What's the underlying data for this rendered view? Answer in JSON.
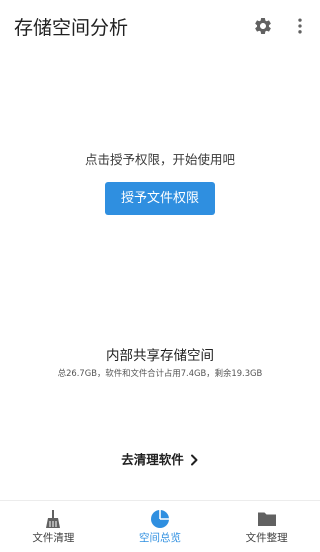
{
  "app_bar": {
    "title": "存储空间分析",
    "icons": {
      "settings": "gear-icon",
      "more": "more-vert-icon"
    }
  },
  "permission": {
    "prompt": "点击授予权限，开始使用吧",
    "button_label": "授予文件权限"
  },
  "storage": {
    "title": "内部共享存储空间",
    "detail": "总26.7GB，软件和文件合计占用7.4GB，剩余19.3GB"
  },
  "clean_link": {
    "label": "去清理软件",
    "icon": "chevron-right-icon"
  },
  "bottom_nav": {
    "active_index": 1,
    "items": [
      {
        "label": "文件清理",
        "icon": "broom-icon"
      },
      {
        "label": "空间总览",
        "icon": "pie-chart-icon"
      },
      {
        "label": "文件整理",
        "icon": "folder-icon"
      }
    ]
  },
  "colors": {
    "accent": "#2f8fe0",
    "icon_gray": "#616161",
    "text_primary": "#212121"
  }
}
